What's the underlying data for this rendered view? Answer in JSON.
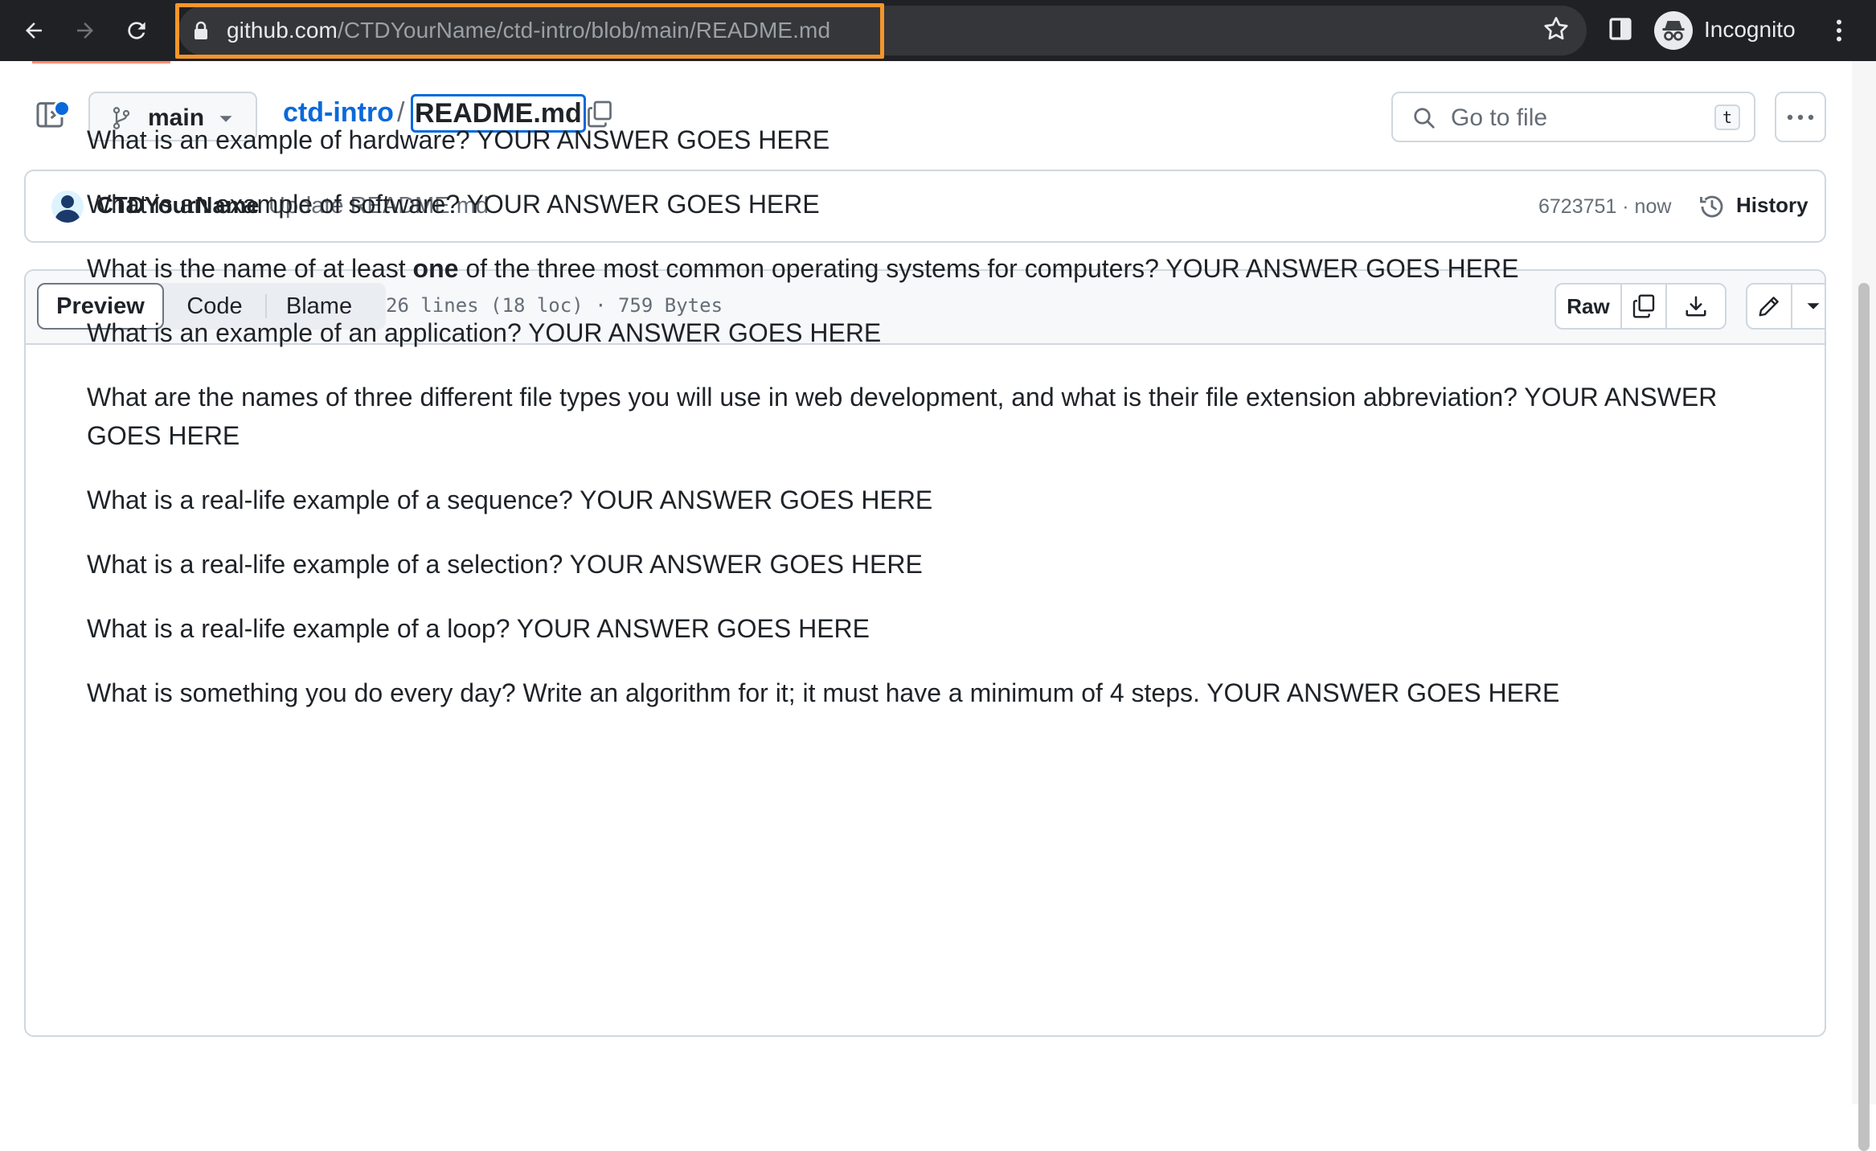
{
  "browser": {
    "url_domain": "github.com",
    "url_path": "/CTDYourName/ctd-intro/blob/main/README.md",
    "profile_label": "Incognito"
  },
  "file_header": {
    "branch": "main",
    "repo": "ctd-intro",
    "separator": "/",
    "file_name": "README.md",
    "goto_placeholder": "Go to file",
    "goto_shortcut": "t"
  },
  "commit": {
    "author": "CTDYourName",
    "message": "Update README.md",
    "sha_time": "6723751 · now",
    "history_label": "History"
  },
  "file_toolbar": {
    "tabs": [
      "Preview",
      "Code",
      "Blame"
    ],
    "meta": "26 lines (18 loc) · 759 Bytes",
    "raw_label": "Raw"
  },
  "readme": {
    "q1": "What is an example of hardware? YOUR ANSWER GOES HERE",
    "q2": "What is an example of software? YOUR ANSWER GOES HERE",
    "q3_before": "What is the name of at least ",
    "q3_bold": "one",
    "q3_after": " of the three most common operating systems for computers? YOUR ANSWER GOES HERE",
    "q4": "What is an example of an application? YOUR ANSWER GOES HERE",
    "q5": "What are the names of three different file types you will use in web development, and what is their file extension abbreviation? YOUR ANSWER GOES HERE",
    "q6": "What is a real-life example of a sequence? YOUR ANSWER GOES HERE",
    "q7": "What is a real-life example of a selection? YOUR ANSWER GOES HERE",
    "q8": "What is a real-life example of a loop? YOUR ANSWER GOES HERE",
    "q9": "What is something you do every day? Write an algorithm for it; it must have a minimum of 4 steps. YOUR ANSWER GOES HERE"
  },
  "colors": {
    "url_highlight": "#f4962a",
    "link": "#0969da",
    "chrome_bg": "#202124"
  }
}
